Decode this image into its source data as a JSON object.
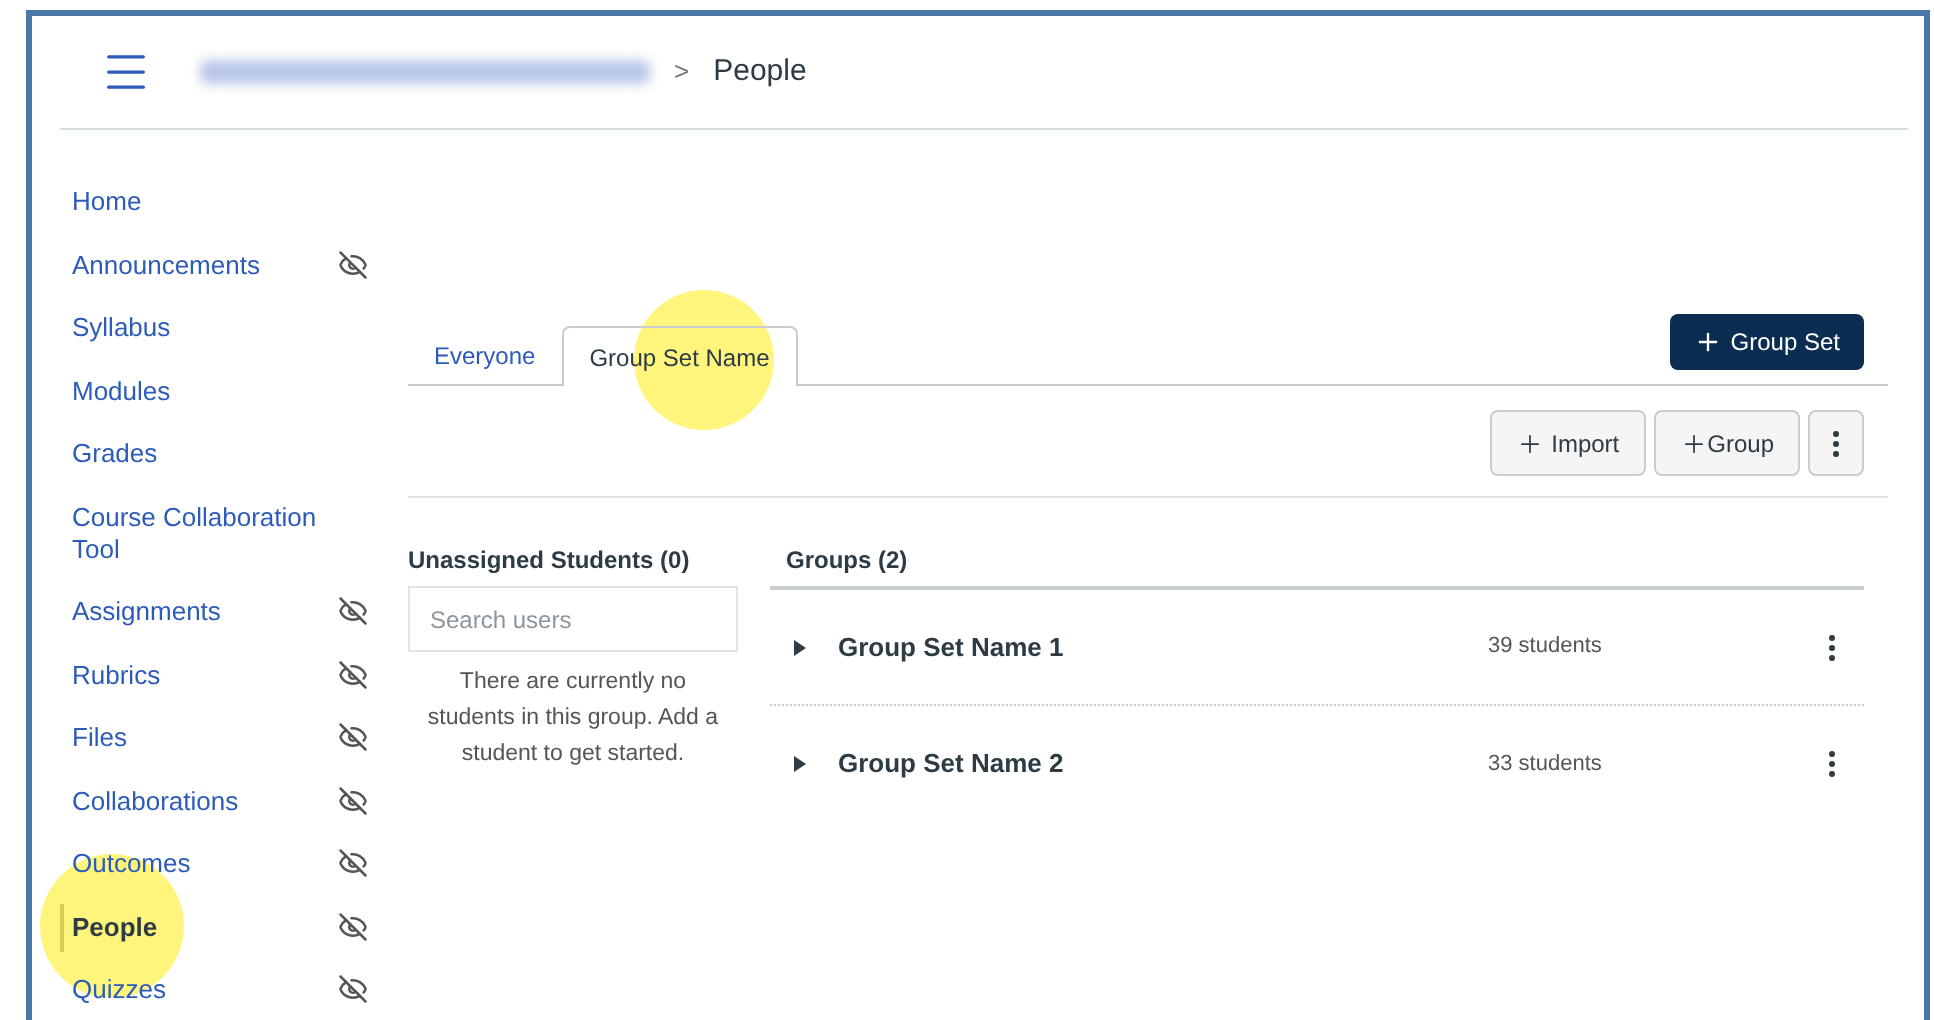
{
  "breadcrumb": {
    "separator": ">",
    "current": "People"
  },
  "sidebar": {
    "items": [
      {
        "label": "Home",
        "hidden": false,
        "selected": false
      },
      {
        "label": "Announcements",
        "hidden": true,
        "selected": false
      },
      {
        "label": "Syllabus",
        "hidden": false,
        "selected": false
      },
      {
        "label": "Modules",
        "hidden": false,
        "selected": false
      },
      {
        "label": "Grades",
        "hidden": false,
        "selected": false
      },
      {
        "label": "Course Collaboration Tool",
        "hidden": false,
        "selected": false
      },
      {
        "label": "Assignments",
        "hidden": true,
        "selected": false
      },
      {
        "label": "Rubrics",
        "hidden": true,
        "selected": false
      },
      {
        "label": "Files",
        "hidden": true,
        "selected": false
      },
      {
        "label": "Collaborations",
        "hidden": true,
        "selected": false
      },
      {
        "label": "Outcomes",
        "hidden": true,
        "selected": false
      },
      {
        "label": "People",
        "hidden": true,
        "selected": true
      },
      {
        "label": "Quizzes",
        "hidden": true,
        "selected": false
      }
    ]
  },
  "tabs": [
    {
      "label": "Everyone",
      "selected": false
    },
    {
      "label": "Group Set Name",
      "selected": true
    }
  ],
  "add_group_set_button": "Group Set",
  "toolbar": {
    "import_button": "Import",
    "group_button": "Group"
  },
  "unassigned": {
    "heading": "Unassigned Students (0)",
    "search": {
      "placeholder": "Search users"
    },
    "empty_message": "There are currently no students in this group. Add a student to get started."
  },
  "groups": {
    "heading": "Groups (2)",
    "rows": [
      {
        "name": "Group Set Name 1",
        "count": "39 students",
        "expanded": false
      },
      {
        "name": "Group Set Name 2",
        "count": "33 students",
        "expanded": false
      }
    ]
  }
}
